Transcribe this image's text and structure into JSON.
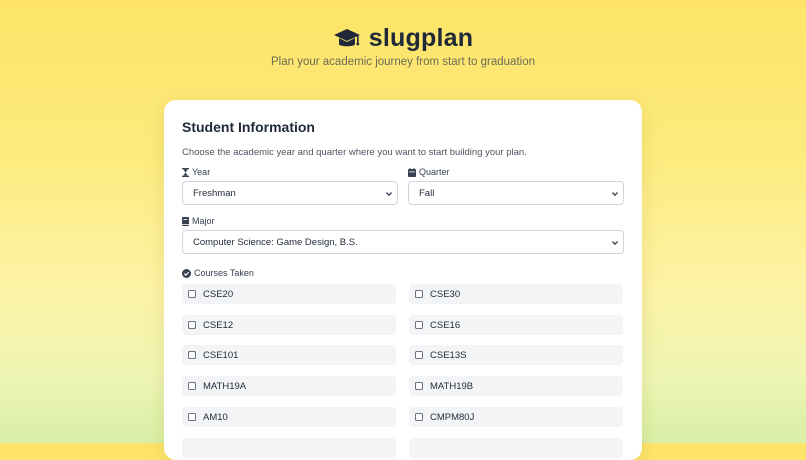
{
  "header": {
    "app_name": "slugplan",
    "tagline": "Plan your academic journey from start to graduation"
  },
  "form": {
    "title": "Student Information",
    "description": "Choose the academic year and quarter where you want to start building your plan.",
    "year": {
      "label": "Year",
      "value": "Freshman"
    },
    "quarter": {
      "label": "Quarter",
      "value": "Fall"
    },
    "major": {
      "label": "Major",
      "value": "Computer Science: Game Design, B.S."
    },
    "courses": {
      "label": "Courses Taken",
      "items": [
        {
          "label": "CSE20",
          "checked": false
        },
        {
          "label": "CSE30",
          "checked": false
        },
        {
          "label": "CSE12",
          "checked": false
        },
        {
          "label": "CSE16",
          "checked": false
        },
        {
          "label": "CSE101",
          "checked": false
        },
        {
          "label": "CSE13S",
          "checked": false
        },
        {
          "label": "MATH19A",
          "checked": false
        },
        {
          "label": "MATH19B",
          "checked": false
        },
        {
          "label": "AM10",
          "checked": false
        },
        {
          "label": "CMPM80J",
          "checked": false
        }
      ]
    }
  },
  "colors": {
    "background_top": "#fde468",
    "background_bottom": "#d8efa6",
    "card": "#ffffff",
    "course_item_bg": "#f3f4f6"
  },
  "icons": {
    "logo": "graduation-cap-icon",
    "year": "hourglass-icon",
    "quarter": "calendar-icon",
    "major": "book-icon",
    "courses": "check-circle-icon",
    "select": "chevron-down-icon"
  }
}
